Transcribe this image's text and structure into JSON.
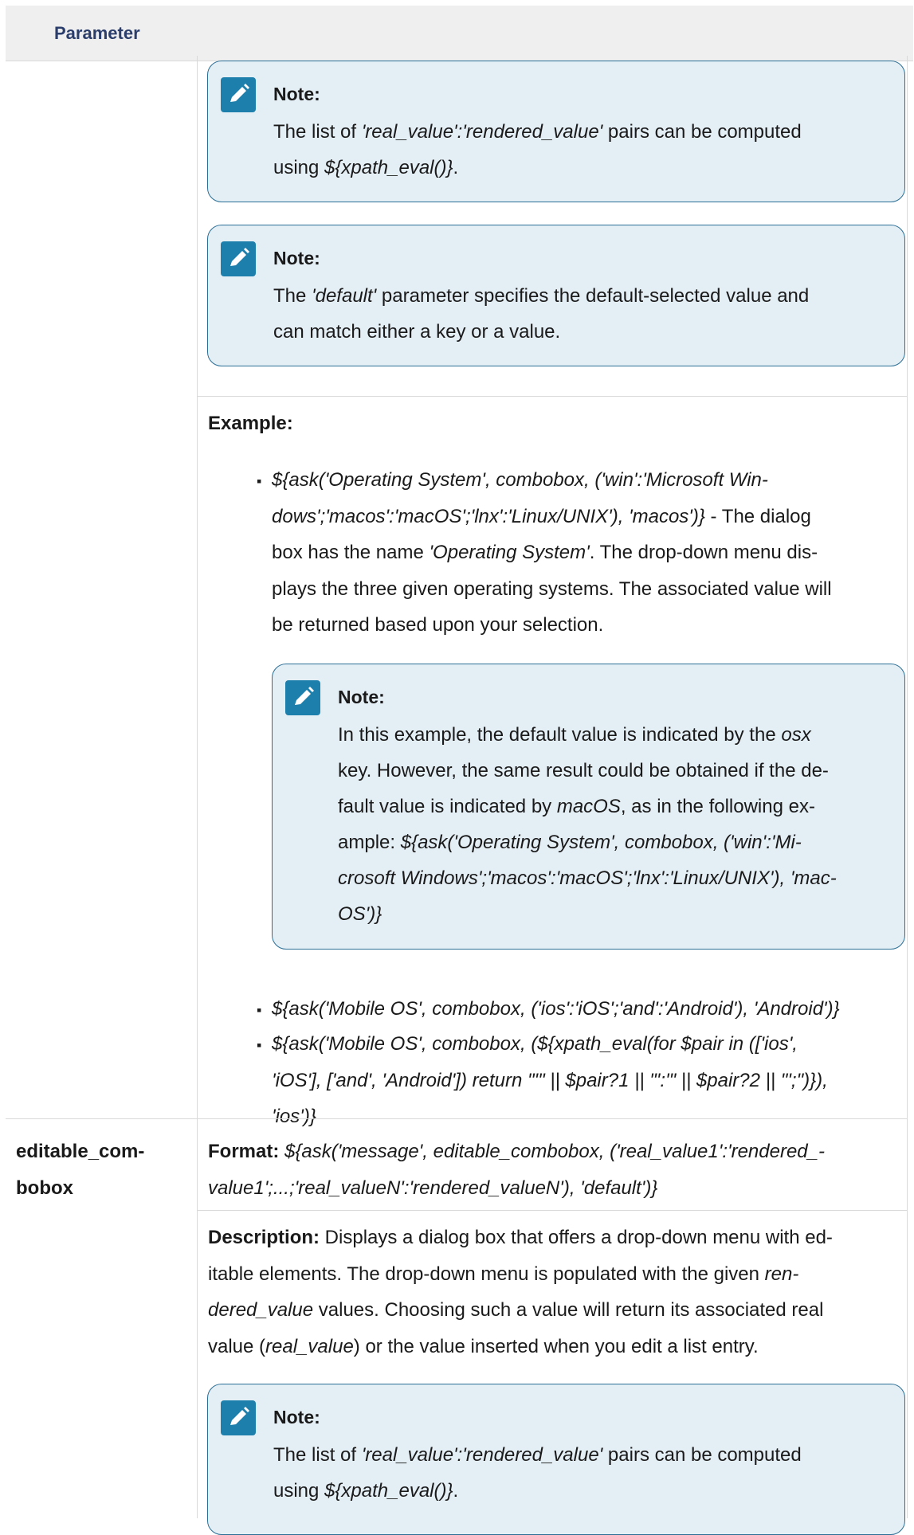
{
  "header": {
    "col1": "Parameter"
  },
  "note_label": "Note:",
  "note1": {
    "t1": "The list of ",
    "i1": "'real_value':'rendered_value'",
    "t2": " pairs can be computed",
    "t3": "using ",
    "i2": "${xpath_eval()}",
    "t4": "."
  },
  "note2": {
    "t1": "The ",
    "i1": "'default'",
    "t2": " parameter specifies the default-selected value and",
    "l2": "can match either a key or a value."
  },
  "example_label": "Example:",
  "example1": {
    "l1": "${ask('Operating System', combobox, ('win':'Microsoft Win-",
    "l2i": "dows';'macos':'macOS';'lnx':'Linux/UNIX'), 'macos')}",
    "l2": " - The dialog",
    "l3a": "box has the name ",
    "l3i": "'Operating System'",
    "l3b": ". The drop-down menu dis-",
    "l4": "plays the three given operating systems. The associated value will",
    "l5": "be returned based upon your selection."
  },
  "note3": {
    "l1a": "In this example, the default value is indicated by the ",
    "l1i": "osx",
    "l2": "key. However, the same result could be obtained if the de-",
    "l3a": "fault value is indicated by ",
    "l3i": "macOS",
    "l3b": ", as in the following ex-",
    "l4a": "ample: ",
    "l4i": "${ask('Operating System', combobox, ('win':'Mi-",
    "l5": "crosoft Windows';'macos':'macOS';'lnx':'Linux/UNIX'), 'mac-",
    "l6": "OS')}"
  },
  "example2": "${ask('Mobile OS', combobox, ('ios':'iOS';'and':'Android'), 'Android')}",
  "example3": {
    "l1": "${ask('Mobile OS', combobox, (${xpath_eval(for $pair in (['ios',",
    "l2": "'iOS'], ['and', 'Android']) return \"'\" || $pair?1 || \"':'\" || $pair?2 || \"';\")}),",
    "l3": "'ios')}"
  },
  "row2": {
    "param_l1": "editable_com-",
    "param_l2": "bobox",
    "format_label": "Format:",
    "format_l1": " ${ask('message', editable_combobox, ('real_value1':'rendered_-",
    "format_l2": "value1';...;'real_valueN':'rendered_valueN'), 'default')}",
    "desc_label": "Description:",
    "desc_l1": " Displays a dialog box that offers a drop-down menu with ed-",
    "desc_l2a": "itable elements. The drop-down menu is populated with the given ",
    "desc_l2i": "ren-",
    "desc_l3i": "dered_value",
    "desc_l3": " values. Choosing such a value will return its associated real",
    "desc_l4a": "value (",
    "desc_l4i": "real_value",
    "desc_l4b": ") or the value inserted when you edit a list entry."
  },
  "colors": {
    "note_bg": "#e4eef5",
    "note_border": "#2b6f96",
    "icon_bg": "#1d7fac",
    "header_text": "#2b3e6b"
  }
}
